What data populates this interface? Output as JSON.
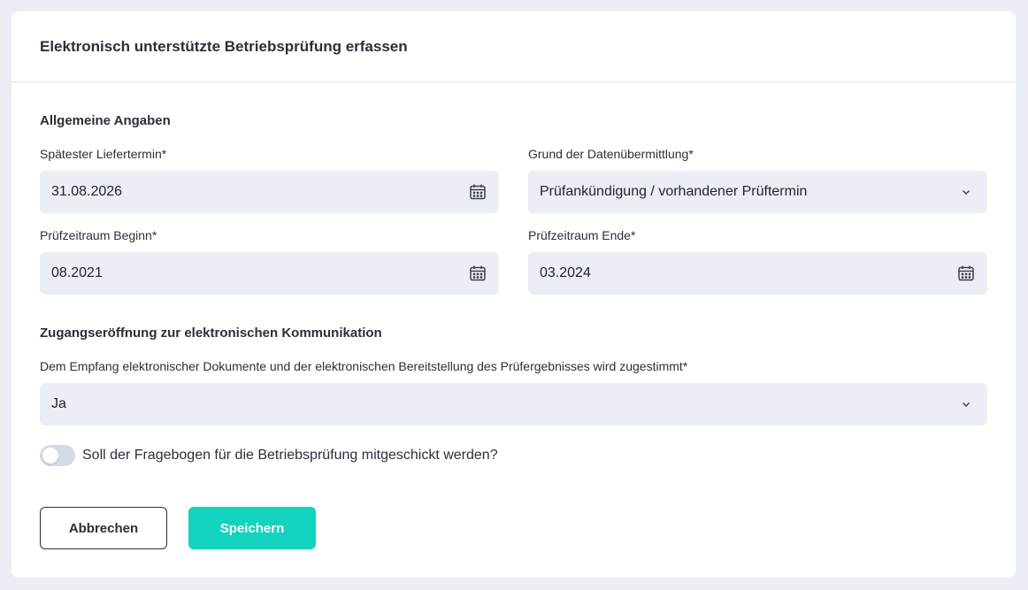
{
  "form": {
    "title": "Elektronisch unterstützte Betriebsprüfung erfassen",
    "general_section": "Allgemeine Angaben",
    "fields": {
      "delivery_date": {
        "label": "Spätester Liefertermin*",
        "value": "31.08.2026",
        "icon": "calendar-icon"
      },
      "transmission_reason": {
        "label": "Grund der Datenübermittlung*",
        "value": "Prüfankündigung / vorhandener Prüftermin",
        "icon": "chevron-down-icon"
      },
      "period_start": {
        "label": "Prüfzeitraum Beginn*",
        "value": "08.2021",
        "icon": "calendar-icon"
      },
      "period_end": {
        "label": "Prüfzeitraum Ende*",
        "value": "03.2024",
        "icon": "calendar-icon"
      }
    },
    "access_section": "Zugangseröffnung zur elektronischen Kommunikation",
    "consent": {
      "label": "Dem Empfang elektronischer Dokumente und der elektronischen Bereitstellung des Prüfergebnisses wird zugestimmt*",
      "value": "Ja",
      "icon": "chevron-down-icon"
    },
    "questionnaire_toggle": {
      "label": "Soll der Fragebogen für die Betriebsprüfung mitgeschickt werden?",
      "enabled": false
    },
    "buttons": {
      "cancel": "Abbrechen",
      "save": "Speichern"
    },
    "colors": {
      "accent": "#12d3bd",
      "field_bg": "#eceef5",
      "page_bg": "#eceef5",
      "text": "#2b2f3a"
    }
  }
}
